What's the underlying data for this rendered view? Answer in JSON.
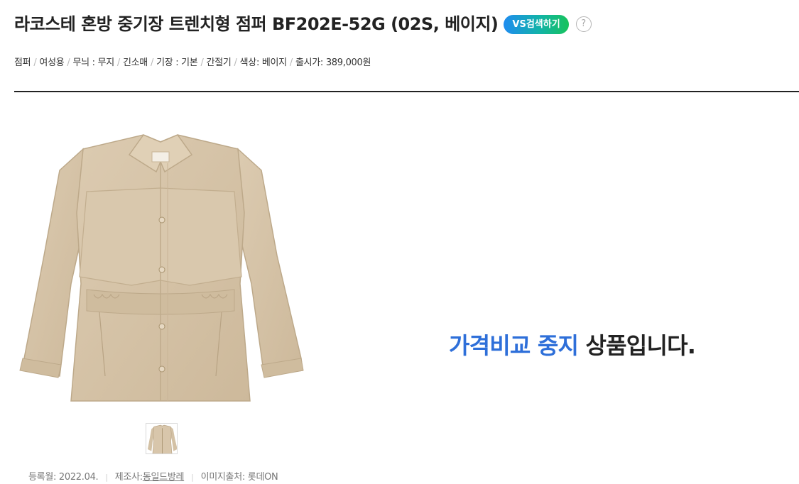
{
  "product": {
    "title": "라코스테 혼방 중기장 트렌치형 점퍼 BF202E-52G (02S, 베이지)",
    "vs_button_label": "VS검색하기",
    "help_icon": "?"
  },
  "specs": [
    "점퍼",
    "여성용",
    "무늬 : 무지",
    "긴소매",
    "기장 : 기본",
    "간절기",
    "색상: 베이지",
    "출시가: 389,000원"
  ],
  "spec_separator": "/",
  "notice": {
    "highlight": "가격비교 중지",
    "rest": " 상품입니다."
  },
  "meta": {
    "registered": "등록월: 2022.04.",
    "manufacturer_label": "제조사:",
    "manufacturer": "동일드방레",
    "image_source": "이미지출처: 롯데ON",
    "separator": "|"
  },
  "colors": {
    "notice_blue": "#2e6fd9",
    "jacket_beige": "#d8c6ab",
    "vs_gradient": [
      "#1f8cf0",
      "#12b3a8",
      "#17c35b"
    ]
  },
  "icons": {
    "help": "question-circle-icon",
    "product_image": "beige-trench-jacket-image"
  }
}
